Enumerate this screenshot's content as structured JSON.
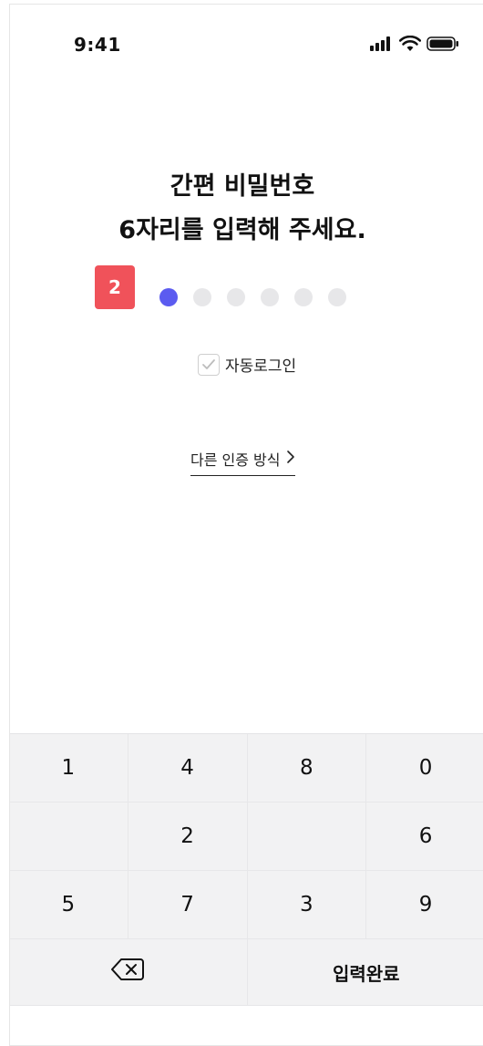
{
  "status_bar": {
    "time": "9:41",
    "icons": [
      "signal-icon",
      "wifi-icon",
      "battery-icon"
    ]
  },
  "title": {
    "line1": "간편 비밀번호",
    "line2": "6자리를 입력해 주세요."
  },
  "step_badge": "2",
  "pin": {
    "length": 6,
    "entered": 1,
    "filled_color": "#5b5bf0",
    "empty_color": "#e7e7e9"
  },
  "auto_login": {
    "label": "자동로그인",
    "checked": true
  },
  "other_auth": {
    "label": "다른 인증 방식",
    "icon": "chevron-right-icon"
  },
  "keypad": {
    "rows": [
      [
        "1",
        "4",
        "8",
        "0"
      ],
      [
        "",
        "2",
        "",
        "6"
      ],
      [
        "5",
        "7",
        "3",
        "9"
      ]
    ],
    "backspace_icon": "backspace-icon",
    "done_label": "입력완료"
  },
  "colors": {
    "accent": "#5b5bf0",
    "badge": "#f0525a"
  }
}
